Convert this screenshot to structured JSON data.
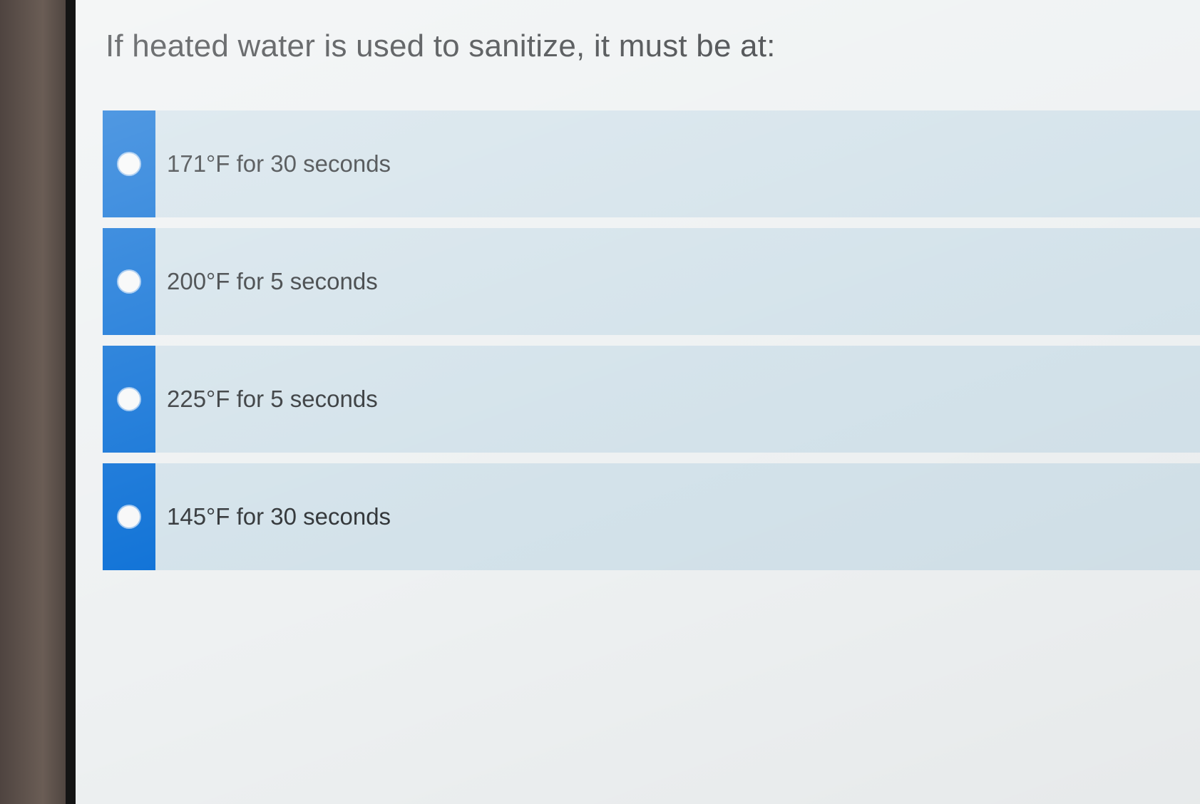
{
  "question": {
    "text": "If heated water is used to sanitize, it must be at:"
  },
  "options": [
    {
      "label": "171°F for 30 seconds",
      "icon": "radio-unselected-icon"
    },
    {
      "label": "200°F for 5 seconds",
      "icon": "radio-unselected-icon"
    },
    {
      "label": "225°F for 5 seconds",
      "icon": "radio-unselected-icon"
    },
    {
      "label": "145°F for 30 seconds",
      "icon": "radio-unselected-icon"
    }
  ],
  "colors": {
    "accent": "#0a6fd6",
    "option_background": "#d3e2ea",
    "page_background": "#eef1f2",
    "text": "#2f3235"
  }
}
